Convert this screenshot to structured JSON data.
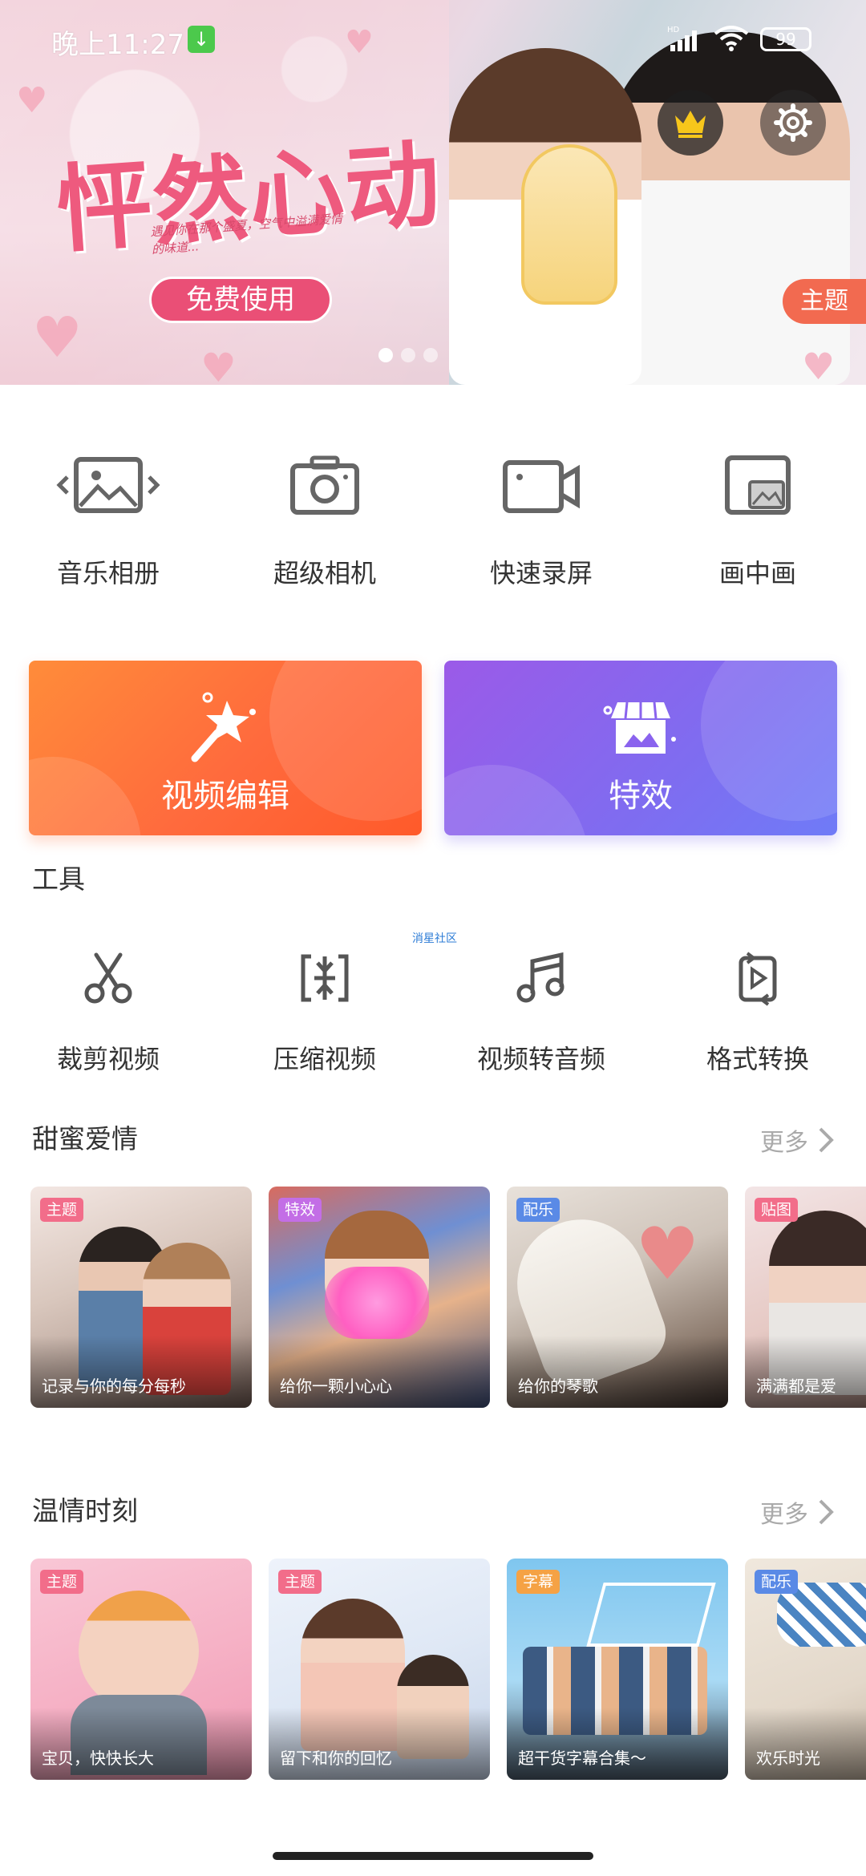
{
  "status_bar": {
    "time": "晚上11:27",
    "battery": "99",
    "network": "HD"
  },
  "banner": {
    "title": "怦然心动",
    "subtitle": "遇见你在那个盛夏，空气中溢满爱情的味道...",
    "cta": "免费使用",
    "tag": "主题",
    "page_indicator": {
      "current": 1,
      "total": 3
    }
  },
  "quick_actions": [
    {
      "label": "音乐相册",
      "icon": "photo-album-icon"
    },
    {
      "label": "超级相机",
      "icon": "camera-icon"
    },
    {
      "label": "快速录屏",
      "icon": "video-record-icon"
    },
    {
      "label": "画中画",
      "icon": "picture-in-picture-icon"
    }
  ],
  "feature_cards": [
    {
      "label": "视频编辑",
      "icon": "magic-wand-icon",
      "color": "#FF6A3D"
    },
    {
      "label": "特效",
      "icon": "store-icon",
      "color": "#8A63EE"
    }
  ],
  "tools": {
    "title": "工具",
    "small_link": "消星社区",
    "items": [
      {
        "label": "裁剪视频",
        "icon": "scissors-icon"
      },
      {
        "label": "压缩视频",
        "icon": "compress-icon"
      },
      {
        "label": "视频转音频",
        "icon": "music-note-icon"
      },
      {
        "label": "格式转换",
        "icon": "convert-icon"
      }
    ]
  },
  "sections": [
    {
      "title": "甜蜜爱情",
      "more": "更多",
      "items": [
        {
          "tag": "主题",
          "caption": "记录与你的每分每秒"
        },
        {
          "tag": "特效",
          "caption": "给你一颗小心心"
        },
        {
          "tag": "配乐",
          "caption": "给你的琴歌"
        },
        {
          "tag": "贴图",
          "caption": "满满都是爱"
        }
      ]
    },
    {
      "title": "温情时刻",
      "more": "更多",
      "items": [
        {
          "tag": "主题",
          "caption": "宝贝，快快长大"
        },
        {
          "tag": "主题",
          "caption": "留下和你的回忆"
        },
        {
          "tag": "字幕",
          "caption": "超干货字幕合集～"
        },
        {
          "tag": "配乐",
          "caption": "欢乐时光"
        }
      ]
    }
  ],
  "colors": {
    "accent_orange": "#FF6A3D",
    "accent_purple": "#8A63EE",
    "banner_pink": "#EA4F76"
  }
}
